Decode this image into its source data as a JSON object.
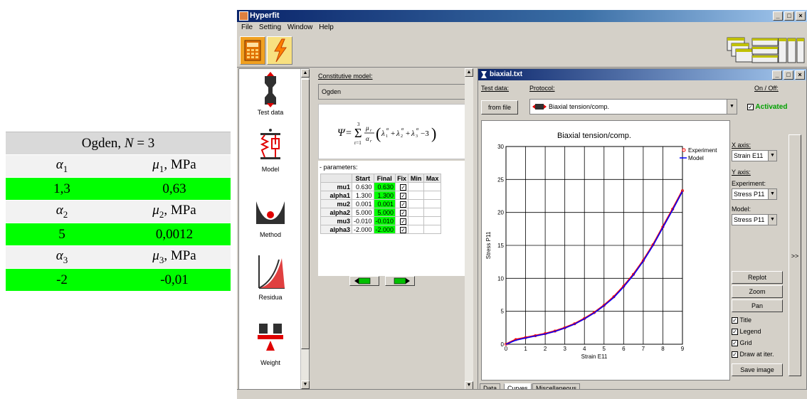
{
  "ogden_table": {
    "header": "Ogden,",
    "header_N": "N",
    "header_eq": " = 3",
    "rows": [
      {
        "label_a": "α",
        "sub_a": "1",
        "label_b": "μ",
        "sub_b": "1",
        "unit": ", MPa",
        "val_a": "1,3",
        "val_b": "0,63"
      },
      {
        "label_a": "α",
        "sub_a": "2",
        "label_b": "μ",
        "sub_b": "2",
        "unit": ", MPa",
        "val_a": "5",
        "val_b": "0,0012"
      },
      {
        "label_a": "α",
        "sub_a": "3",
        "label_b": "μ",
        "sub_b": "3",
        "unit": ", MPa",
        "val_a": "-2",
        "val_b": "-0,01"
      }
    ]
  },
  "app": {
    "title": "Hyperfit",
    "menu": [
      "File",
      "Setting",
      "Window",
      "Help"
    ],
    "sidebar": [
      "Test data",
      "Model",
      "Method",
      "Residua",
      "Weight"
    ]
  },
  "model_panel": {
    "label": "Constitutive model:",
    "selected": "Ogden",
    "params_label": "- parameters:",
    "columns": [
      "Start",
      "Final",
      "Fix",
      "Min",
      "Max"
    ],
    "params": [
      {
        "name": "mu1",
        "start": "0.630",
        "final": "0.630"
      },
      {
        "name": "alpha1",
        "start": "1.300",
        "final": "1.300"
      },
      {
        "name": "mu2",
        "start": "0.001",
        "final": "0.001"
      },
      {
        "name": "alpha2",
        "start": "5.000",
        "final": "5.000"
      },
      {
        "name": "mu3",
        "start": "-0.010",
        "final": "-0.010"
      },
      {
        "name": "alpha3",
        "start": "-2.000",
        "final": "-2.000"
      }
    ]
  },
  "child": {
    "title": "biaxial.txt",
    "test_data_label": "Test data:",
    "from_file": "from file",
    "protocol_label": "Protocol:",
    "protocol": "Biaxial tension/comp.",
    "onoff_label": "On / Off:",
    "activated": "Activated",
    "xaxis_label": "X axis:",
    "xaxis": "Strain E11",
    "yaxis_label": "Y axis:",
    "experiment_label": "Experiment:",
    "experiment": "Stress P11",
    "model_label": "Model:",
    "model": "Stress P11",
    "buttons": [
      "Replot",
      "Zoom",
      "Pan"
    ],
    "checks": [
      "Title",
      "Legend",
      "Grid",
      "Draw at iter."
    ],
    "save_image": "Save image",
    "expand": ">>",
    "tabs": [
      "Data",
      "Curves",
      "Miscellaneous"
    ]
  },
  "chart_data": {
    "type": "line",
    "title": "Biaxial tension/comp.",
    "xlabel": "Strain E11",
    "ylabel": "Stress P11",
    "xlim": [
      0,
      9
    ],
    "ylim": [
      0,
      30
    ],
    "xticks": [
      "0",
      "1",
      "2",
      "3",
      "4",
      "5",
      "6",
      "7",
      "8",
      "9"
    ],
    "yticks": [
      "0",
      "5",
      "10",
      "15",
      "20",
      "25",
      "30"
    ],
    "grid": true,
    "legend": "top-right",
    "series": [
      {
        "name": "Experiment",
        "color": "#ff0000",
        "x": [
          0,
          0.5,
          1,
          1.5,
          2,
          2.5,
          3,
          3.5,
          4,
          4.5,
          5,
          5.5,
          6,
          6.5,
          7,
          7.5,
          8,
          8.5,
          9
        ],
        "y": [
          0,
          0.7,
          1.0,
          1.3,
          1.6,
          2.0,
          2.5,
          3.1,
          3.9,
          4.8,
          5.9,
          7.2,
          8.8,
          10.6,
          12.7,
          15.1,
          17.8,
          20.5,
          23.3
        ]
      },
      {
        "name": "Model",
        "color": "#0000ff",
        "x": [
          0,
          0.5,
          1,
          1.5,
          2,
          2.5,
          3,
          3.5,
          4,
          4.5,
          5,
          5.5,
          6,
          6.5,
          7,
          7.5,
          8,
          8.5,
          9
        ],
        "y": [
          0,
          0.6,
          0.95,
          1.25,
          1.55,
          1.95,
          2.45,
          3.05,
          3.85,
          4.75,
          5.85,
          7.1,
          8.7,
          10.5,
          12.6,
          15.0,
          17.7,
          20.4,
          23.2
        ]
      }
    ]
  }
}
